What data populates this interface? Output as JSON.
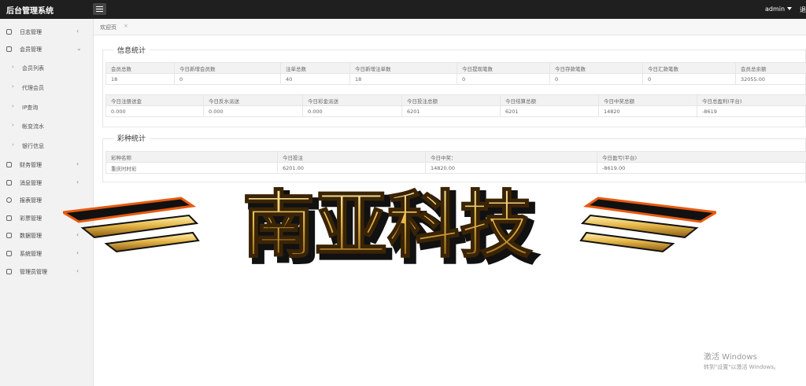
{
  "app": {
    "title": "后台管理系统"
  },
  "header": {
    "username": "admin",
    "logout": "退"
  },
  "sidebar": {
    "items": [
      {
        "label": "日志管理",
        "icon": "user-icon",
        "arrow": "‹"
      },
      {
        "label": "会员管理",
        "icon": "user-icon",
        "arrow": "⌄"
      },
      {
        "label": "财务管理",
        "icon": "book-icon",
        "arrow": "‹"
      },
      {
        "label": "消息管理",
        "icon": "message-icon",
        "arrow": "‹"
      },
      {
        "label": "报表管理",
        "icon": "refresh-icon",
        "arrow": ""
      },
      {
        "label": "彩票管理",
        "icon": "lottery-icon",
        "arrow": ""
      },
      {
        "label": "数据管理",
        "icon": "user-icon",
        "arrow": "‹"
      },
      {
        "label": "系统管理",
        "icon": "user-icon",
        "arrow": "‹"
      },
      {
        "label": "管理员管理",
        "icon": "user-icon",
        "arrow": "‹"
      }
    ],
    "subitems": [
      {
        "label": "会员列表"
      },
      {
        "label": "代理会员"
      },
      {
        "label": "IP查询"
      },
      {
        "label": "帐变流水"
      },
      {
        "label": "银行信息"
      }
    ]
  },
  "tabs": {
    "welcome": "欢迎页",
    "close": "×"
  },
  "info": {
    "title": "信息统计",
    "row1_headers": [
      "会员总数",
      "今日新增会员数",
      "注单总数",
      "今日新增注单数",
      "今日提现笔数",
      "今日存款笔数",
      "今日汇款笔数",
      "会员总余额"
    ],
    "row1_values": [
      "18",
      "0",
      "40",
      "18",
      "0",
      "0",
      "0",
      "32055.00"
    ],
    "row2_headers": [
      "今日注册送金",
      "今日反水派送",
      "今日彩金派送",
      "今日投注总额",
      "今日结算总额",
      "今日中奖总额",
      "今日总盈利(平台)"
    ],
    "row2_values": [
      "0.000",
      "0.000",
      "0.000",
      "6201",
      "6201",
      "14820",
      "-8619"
    ]
  },
  "lottery": {
    "title": "彩种统计",
    "headers": [
      "彩种名称",
      "今日投注",
      "今日中奖：",
      "今日盈亏(平台)"
    ],
    "rows": [
      [
        "重庆时时彩",
        "6201.00",
        "14820.00",
        "-8619.00"
      ]
    ]
  },
  "logo": {
    "text": "南亚科技"
  },
  "watermark": {
    "line1": "激活 Windows",
    "line2": "转到\"设置\"以激活 Windows。"
  }
}
